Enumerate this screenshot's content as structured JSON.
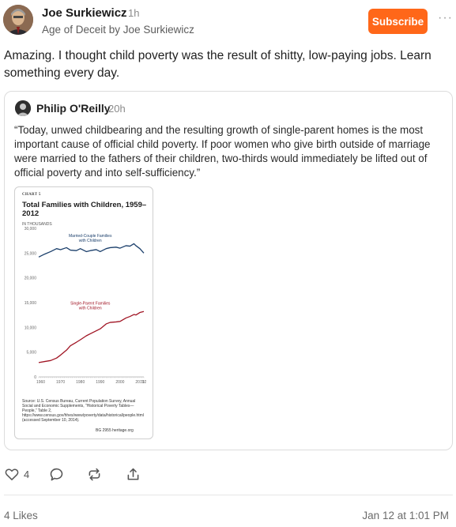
{
  "post": {
    "author": "Joe Surkiewicz",
    "time": "1h",
    "publication": "Age of Deceit by Joe Surkiewicz",
    "subscribe_label": "Subscribe",
    "more_label": "···",
    "text": "Amazing. I thought child poverty was the result of shitty, low-paying jobs. Learn something every day."
  },
  "quote": {
    "author": "Philip O'Reilly",
    "time": "20h",
    "text": "“Today, unwed childbearing and the resulting growth of single-parent homes is the most important cause of official child poverty. If poor women who give birth outside of marriage were married to the fathers of their children, two-thirds would immediately be lifted out of official poverty and into self-sufficiency.”"
  },
  "chart_card": {
    "tag": "CHART 5",
    "title": "Total Families with Children, 1959–2012",
    "units": "IN THOUSANDS",
    "source": "Source: U.S. Census Bureau, Current Population Survey, Annual Social and Economic Supplements, “Historical Poverty Tables—People,” Table 2, https://www.census.gov/hhes/www/poverty/data/historical/people.html (accessed September 10, 2014).",
    "footer": "BG 2955  heritage.org"
  },
  "chart_data": {
    "type": "line",
    "title": "Total Families with Children, 1959–2012",
    "ylabel": "IN THOUSANDS",
    "ylim": [
      0,
      30000
    ],
    "yticks": [
      0,
      5000,
      10000,
      15000,
      20000,
      25000,
      30000
    ],
    "ytick_labels": [
      "0",
      "5,000",
      "10,000",
      "15,000",
      "20,000",
      "25,000",
      "30,000"
    ],
    "xlim": [
      1959,
      2012
    ],
    "xtick_labels": [
      {
        "year": 1960,
        "label": "1960"
      },
      {
        "year": 1970,
        "label": "1970"
      },
      {
        "year": 1980,
        "label": "1980"
      },
      {
        "year": 1990,
        "label": "1990"
      },
      {
        "year": 2000,
        "label": "2000"
      },
      {
        "year": 2010,
        "label": "2010"
      },
      {
        "year": 2012,
        "label": "’12"
      }
    ],
    "grid": false,
    "series": [
      {
        "name": "Married-Couple Families with Children",
        "label_lines": [
          "Married-Couple Families",
          "with Children"
        ],
        "color": "#1b3f6b",
        "x": [
          1959,
          1962,
          1965,
          1968,
          1970,
          1973,
          1975,
          1978,
          1980,
          1983,
          1985,
          1988,
          1990,
          1993,
          1995,
          1998,
          2000,
          2003,
          2005,
          2007,
          2008,
          2010,
          2012
        ],
        "values": [
          24200,
          24800,
          25300,
          25900,
          25700,
          26100,
          25600,
          25500,
          25900,
          25300,
          25500,
          25700,
          25300,
          25900,
          26100,
          26200,
          26000,
          26500,
          26400,
          26900,
          26500,
          25900,
          25000
        ]
      },
      {
        "name": "Single-Parent Families with Children",
        "label_lines": [
          "Single-Parent Families",
          "with Children"
        ],
        "color": "#a01423",
        "x": [
          1959,
          1962,
          1965,
          1968,
          1970,
          1973,
          1975,
          1978,
          1980,
          1983,
          1985,
          1988,
          1990,
          1993,
          1995,
          1998,
          2000,
          2003,
          2005,
          2007,
          2008,
          2010,
          2012
        ],
        "values": [
          2900,
          3100,
          3300,
          3800,
          4400,
          5400,
          6300,
          7000,
          7500,
          8300,
          8700,
          9300,
          9700,
          10700,
          11000,
          11100,
          11200,
          11900,
          12200,
          12600,
          12500,
          13000,
          13200
        ]
      }
    ]
  },
  "actions": {
    "like_count": "4",
    "likes_text": "4 Likes",
    "date": "Jan 12 at 1:01 PM"
  }
}
